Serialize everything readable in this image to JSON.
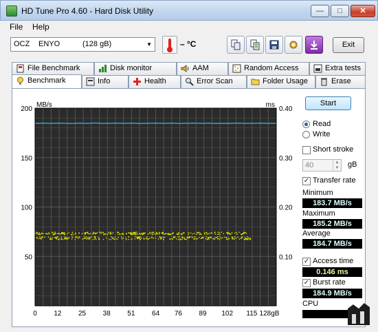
{
  "window": {
    "title": "HD Tune Pro 4.60 - Hard Disk Utility",
    "min_label": "—",
    "max_label": "□",
    "close_label": "✕"
  },
  "menu": {
    "file": "File",
    "help": "Help"
  },
  "toolbar": {
    "drive_brand": "OCZ",
    "drive_model": "ENYO",
    "drive_size": "(128 gB)",
    "temperature": "– °C",
    "exit_label": "Exit",
    "icons": [
      "copy-icon",
      "copy-text-icon",
      "save-icon",
      "options-icon",
      "download-icon"
    ]
  },
  "tabs_row1": [
    {
      "label": "File Benchmark",
      "icon": "file-benchmark-icon"
    },
    {
      "label": "Disk monitor",
      "icon": "disk-monitor-icon"
    },
    {
      "label": "AAM",
      "icon": "speaker-icon"
    },
    {
      "label": "Random Access",
      "icon": "random-access-icon"
    },
    {
      "label": "Extra tests",
      "icon": "extra-tests-icon"
    }
  ],
  "tabs_row2": [
    {
      "label": "Benchmark",
      "icon": "benchmark-icon",
      "active": true
    },
    {
      "label": "Info",
      "icon": "info-icon"
    },
    {
      "label": "Health",
      "icon": "health-icon"
    },
    {
      "label": "Error Scan",
      "icon": "magnifier-icon"
    },
    {
      "label": "Folder Usage",
      "icon": "folder-icon"
    },
    {
      "label": "Erase",
      "icon": "trash-icon"
    }
  ],
  "controls": {
    "start_label": "Start",
    "read_label": "Read",
    "write_label": "Write",
    "mode_selected": "Read",
    "short_stroke_label": "Short stroke",
    "short_stroke_checked": false,
    "short_stroke_value": "40",
    "short_stroke_unit": "gB",
    "transfer_rate_label": "Transfer rate",
    "transfer_rate_checked": true,
    "minimum_label": "Minimum",
    "minimum_value": "183.7 MB/s",
    "maximum_label": "Maximum",
    "maximum_value": "185.2 MB/s",
    "average_label": "Average",
    "average_value": "184.7 MB/s",
    "access_time_label": "Access time",
    "access_time_checked": true,
    "access_time_value": "0.146 ms",
    "burst_rate_label": "Burst rate",
    "burst_rate_checked": true,
    "burst_rate_value": "184.9 MB/s",
    "cpu_label": "CPU"
  },
  "chart_data": {
    "type": "line",
    "y_left_unit": "MB/s",
    "y_right_unit": "ms",
    "y_left_ticks": [
      "200",
      "150",
      "100",
      "50"
    ],
    "y_right_ticks": [
      "0.40",
      "0.30",
      "0.20",
      "0.10"
    ],
    "ylim_left": [
      0,
      200
    ],
    "ylim_right": [
      0,
      0.4
    ],
    "x_ticks": [
      "0",
      "12",
      "25",
      "38",
      "51",
      "64",
      "76",
      "89",
      "102",
      "115",
      "128gB"
    ],
    "xlim": [
      0,
      128
    ],
    "grid": true,
    "background": "#2b2b2b",
    "series": [
      {
        "axis": "left",
        "color": "#2aa6d6",
        "x": [
          0,
          4,
          8,
          12,
          16,
          20,
          24,
          28,
          32,
          36,
          40,
          44,
          48,
          52,
          56,
          60,
          64,
          68,
          72,
          76,
          80,
          84,
          88,
          92,
          96,
          100,
          104,
          108,
          112,
          116,
          120,
          124,
          128
        ],
        "values": [
          184.6,
          184.8,
          184.5,
          184.9,
          184.7,
          184.4,
          184.8,
          184.6,
          185.0,
          184.5,
          184.7,
          184.9,
          184.6,
          184.8,
          184.4,
          184.7,
          184.9,
          184.6,
          184.8,
          184.5,
          184.7,
          184.9,
          184.6,
          184.8,
          184.5,
          184.7,
          184.6,
          184.9,
          184.5,
          184.7,
          184.8,
          184.6,
          184.7
        ]
      },
      {
        "axis": "right",
        "color": "#e6e600",
        "style": "scatter",
        "x_range": [
          0,
          115
        ],
        "values_upper_band": [
          0.145,
          0.15
        ],
        "values_lower_band": [
          0.135,
          0.141
        ]
      }
    ]
  },
  "colors": {
    "chart_bg": "#2b2b2b",
    "grid": "#555555",
    "transfer_line": "#2aa6d6",
    "access_dots": "#e6e600",
    "stat_text": "#ccffff"
  }
}
